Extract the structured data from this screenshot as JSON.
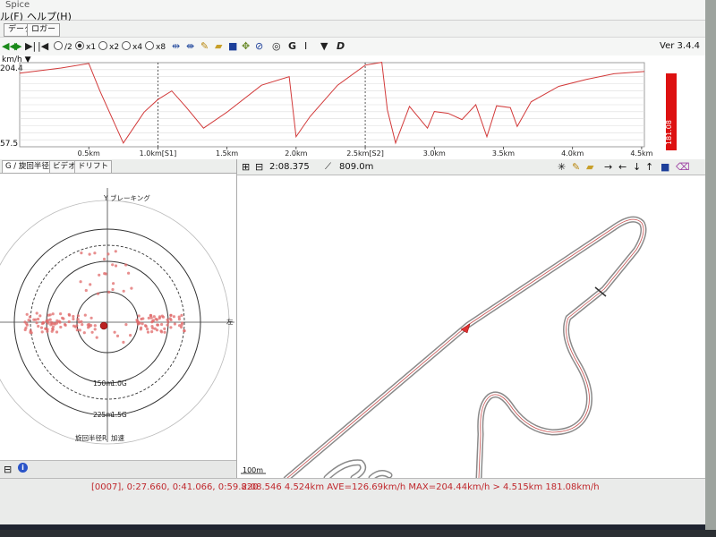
{
  "menu": {
    "title_fragment": "Spice",
    "file": "ル(F)",
    "help": "ヘルプ(H)"
  },
  "tabs": [
    "データ",
    "ロガー"
  ],
  "toolbar": {
    "radios": [
      "/2",
      "x1",
      "x2",
      "x4",
      "x8"
    ],
    "selected_radio": "x1",
    "letters": [
      "G",
      "D"
    ],
    "version": "Ver 3.4.4"
  },
  "speed_chart": {
    "unit_label": "km/h ▼",
    "y_max_label": "204.4",
    "y_min_label": "57.5",
    "x_ticks": [
      "0.5km",
      "1.0km[S1]",
      "1.5km",
      "2.0km",
      "2.5km[S2]",
      "3.0km",
      "3.5km",
      "4.0km",
      "4.5km"
    ],
    "marker_value": "181.08",
    "line_color": "#d23a3a"
  },
  "chart_data": {
    "type": "line",
    "title": "",
    "xlabel": "",
    "ylabel": "km/h",
    "ylim": [
      57.5,
      204.4
    ],
    "xlim": [
      0,
      4.52
    ],
    "x": [
      0.0,
      0.3,
      0.5,
      0.58,
      0.75,
      0.9,
      1.0,
      1.1,
      1.2,
      1.33,
      1.5,
      1.75,
      1.95,
      2.0,
      2.1,
      2.3,
      2.5,
      2.62,
      2.66,
      2.72,
      2.82,
      2.95,
      3.0,
      3.1,
      3.2,
      3.3,
      3.38,
      3.45,
      3.55,
      3.6,
      3.7,
      3.9,
      4.1,
      4.3,
      4.52
    ],
    "series": [
      {
        "name": "",
        "values": [
          186,
          195,
          203,
          155,
          64,
          118,
          140,
          155,
          128,
          90,
          118,
          165,
          180,
          75,
          110,
          165,
          200,
          205,
          122,
          64,
          128,
          90,
          119,
          116,
          105,
          131,
          75,
          129,
          126,
          93,
          136,
          163,
          175,
          185,
          189
        ]
      }
    ]
  },
  "gpanel": {
    "tabs": [
      "G / 旋回半径",
      "ビデオ",
      "ドリフト"
    ],
    "top_label": "Y ブレーキング",
    "right_label": "左",
    "ring_label_1": "150m",
    "ring_g_1": "1.0G",
    "ring_label_2": "225m",
    "ring_g_2": "1.5G",
    "bottom_label_1": "旋回半径R",
    "bottom_label_2": "加速"
  },
  "map": {
    "time": "2:08.375",
    "distance": "809.0m",
    "scale": "100m",
    "arrows": [
      "→",
      "←",
      "↓",
      "↑"
    ],
    "track_color": "#7a7a7a"
  },
  "status": {
    "left": "[0007], 0:27.660, 0:41.066, 0:59.820",
    "right": "2:08.546 4.524km AVE=126.69km/h MAX=204.44km/h > 4.515km 181.08km/h"
  }
}
